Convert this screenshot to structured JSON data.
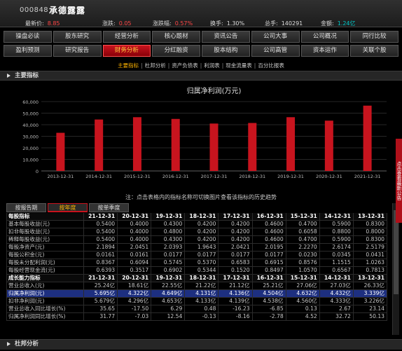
{
  "quote": {
    "code": "000848",
    "name": "承德露露",
    "latest_label": "最新价:",
    "latest": "8.85",
    "change_label": "涨跌:",
    "change": "0.05",
    "pct_label": "涨跌幅:",
    "pct": "0.57%",
    "turnover_label": "换手:",
    "turnover": "1.30%",
    "volume_label": "总手:",
    "volume": "140291",
    "amount_label": "金额:",
    "amount": "1.24亿"
  },
  "nav_row1": [
    "操盘必读",
    "股东研究",
    "经营分析",
    "核心题材",
    "资讯公告",
    "公司大事",
    "公司概况",
    "同行比较"
  ],
  "nav_row2": [
    "盈利预测",
    "研究报告",
    "财务分析",
    "分红融资",
    "股本结构",
    "公司高管",
    "资本运作",
    "关联个股"
  ],
  "nav_active": "财务分析",
  "subtabs": [
    "主要指标",
    "杜邦分析",
    "资产负债表",
    "利润表",
    "现金流量表",
    "百分比报表"
  ],
  "subtab_active": "主要指标",
  "section_main": "主要指标",
  "colors": {
    "bar": "#c8141e",
    "highlight_row": "#1d2f80",
    "active_tab": "#c8141e",
    "accent": "#ffb400"
  },
  "chart_data": {
    "type": "bar",
    "title": "归属净利润(万元)",
    "categories": [
      "2013-12-31",
      "2014-12-31",
      "2015-12-31",
      "2016-12-31",
      "2017-12-31",
      "2018-12-31",
      "2019-12-31",
      "2020-12-31",
      "2021-12-31"
    ],
    "values": [
      33000,
      44500,
      46500,
      45000,
      41000,
      41500,
      46500,
      43500,
      56500
    ],
    "ylim": [
      0,
      60000
    ],
    "yticks": [
      "0",
      "10,000",
      "20,000",
      "30,000",
      "40,000",
      "50,000",
      "60,000"
    ],
    "grid": true
  },
  "tip": "注：点击表格内的指标名称可切换图片查看该指标的历史趋势",
  "table_tabs": [
    "按报告期",
    "按年度",
    "按单季度"
  ],
  "table_tab_active": "按年度",
  "dates": [
    "21-12-31",
    "20-12-31",
    "19-12-31",
    "18-12-31",
    "17-12-31",
    "16-12-31",
    "15-12-31",
    "14-12-31",
    "13-12-31"
  ],
  "section1_title": "每股指标",
  "section1_rows": [
    {
      "label": "基本每股收益(元)",
      "values": [
        "0.5400",
        "0.4000",
        "0.4300",
        "0.4200",
        "0.4200",
        "0.4600",
        "0.4700",
        "0.5900",
        "0.8300"
      ]
    },
    {
      "label": "扣非每股收益(元)",
      "values": [
        "0.5400",
        "0.4000",
        "0.4800",
        "0.4200",
        "0.4200",
        "0.4600",
        "0.6058",
        "0.8800",
        "0.8000"
      ]
    },
    {
      "label": "稀释每股收益(元)",
      "values": [
        "0.5400",
        "0.4000",
        "0.4300",
        "0.4200",
        "0.4200",
        "0.4600",
        "0.4700",
        "0.5900",
        "0.8300"
      ]
    },
    {
      "label": "每股净资产(元)",
      "values": [
        "2.1894",
        "2.0451",
        "2.0393",
        "1.9643",
        "2.0421",
        "2.0195",
        "2.2270",
        "2.6174",
        "2.5179"
      ]
    },
    {
      "label": "每股公积金(元)",
      "values": [
        "0.0161",
        "0.0161",
        "0.0177",
        "0.0177",
        "0.0177",
        "0.0177",
        "0.0230",
        "0.0345",
        "0.0431"
      ]
    },
    {
      "label": "每股未分配利润(元)",
      "values": [
        "0.8367",
        "0.6094",
        "0.5745",
        "0.5370",
        "0.6583",
        "0.6915",
        "0.8576",
        "1.1515",
        "1.0263"
      ]
    },
    {
      "label": "每股经营现金流(元)",
      "values": [
        "0.6393",
        "0.3517",
        "0.6902",
        "0.5344",
        "0.1520",
        "0.8497",
        "1.0570",
        "0.6567",
        "0.7813"
      ]
    }
  ],
  "section2_title": "成长能力指标",
  "section2_rows": [
    {
      "label": "营业总收入(元)",
      "values": [
        "25.24亿",
        "18.61亿",
        "22.55亿",
        "21.22亿",
        "21.12亿",
        "25.21亿",
        "27.06亿",
        "27.03亿",
        "26.33亿"
      ]
    },
    {
      "label": "归属净利润(元)",
      "values": [
        "5.695亿",
        "4.322亿",
        "4.649亿",
        "4.131亿",
        "4.136亿",
        "4.504亿",
        "4.632亿",
        "4.432亿",
        "3.339亿"
      ],
      "highlight": true
    },
    {
      "label": "扣非净利润(元)",
      "values": [
        "5.679亿",
        "4.296亿",
        "4.653亿",
        "4.133亿",
        "4.139亿",
        "4.538亿",
        "4.560亿",
        "4.333亿",
        "3.226亿"
      ]
    },
    {
      "label": "营业总收入同比增长(%)",
      "values": [
        "35.65",
        "-17.50",
        "6.29",
        "0.48",
        "-16.23",
        "-6.85",
        "0.13",
        "2.67",
        "23.14"
      ]
    },
    {
      "label": "归属净利润同比增长(%)",
      "values": [
        "31.77",
        "-7.03",
        "12.54",
        "-0.13",
        "-8.16",
        "-2.78",
        "4.52",
        "32.72",
        "50.13"
      ]
    }
  ],
  "section_bottom": "杜邦分析",
  "side_tab": "点击查看最新公告"
}
